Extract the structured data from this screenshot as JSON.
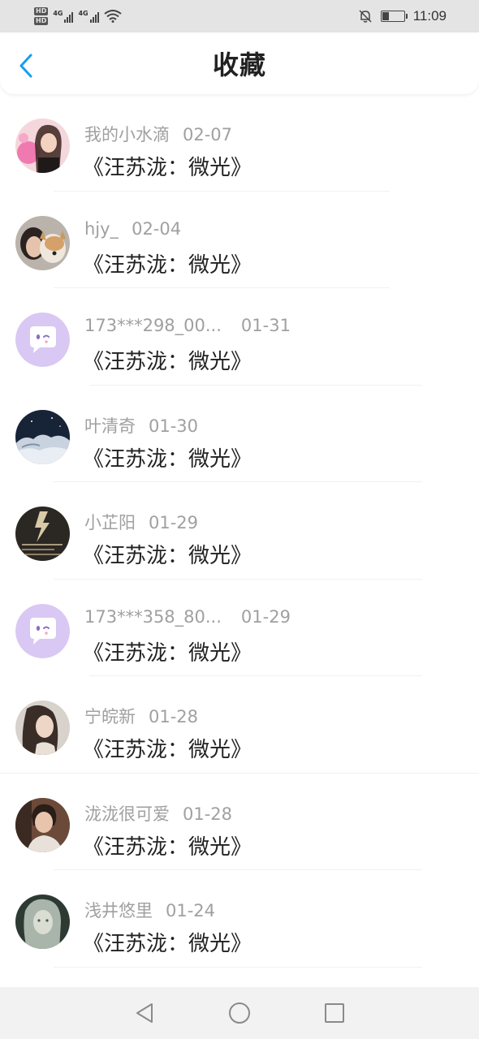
{
  "status_bar": {
    "hd1": "HD",
    "hd2": "HD",
    "net1": "4G",
    "net2": "4G",
    "time": "11:09",
    "battery_level": 0.3,
    "icons": [
      "signal-icon",
      "wifi-icon",
      "mute-bell-icon",
      "battery-icon"
    ]
  },
  "header": {
    "title": "收藏",
    "back_icon": "chevron-left-icon",
    "accent_color": "#1a9cf0"
  },
  "items": [
    {
      "name": "我的小水滴",
      "date": "02-07",
      "title": "《汪苏泷：微光》",
      "avatar": "photo-avatar"
    },
    {
      "name": "hjy_",
      "date": "02-04",
      "title": "《汪苏泷：微光》",
      "avatar": "photo-avatar"
    },
    {
      "name": "173***298_00...",
      "date": "01-31",
      "title": "《汪苏泷：微光》",
      "avatar": "chat-bubble-avatar"
    },
    {
      "name": "叶清奇",
      "date": "01-30",
      "title": "《汪苏泷：微光》",
      "avatar": "photo-avatar"
    },
    {
      "name": "小芷阳",
      "date": "01-29",
      "title": "《汪苏泷：微光》",
      "avatar": "photo-avatar"
    },
    {
      "name": "173***358_80...",
      "date": "01-29",
      "title": "《汪苏泷：微光》",
      "avatar": "chat-bubble-avatar"
    },
    {
      "name": "宁皖新",
      "date": "01-28",
      "title": "《汪苏泷：微光》",
      "avatar": "photo-avatar"
    },
    {
      "name": "泷泷很可爱",
      "date": "01-28",
      "title": "《汪苏泷：微光》",
      "avatar": "photo-avatar"
    },
    {
      "name": "浅井悠里",
      "date": "01-24",
      "title": "《汪苏泷：微光》",
      "avatar": "photo-avatar"
    }
  ],
  "bottom_nav": [
    "back-triangle-icon",
    "home-circle-icon",
    "recents-square-icon"
  ]
}
